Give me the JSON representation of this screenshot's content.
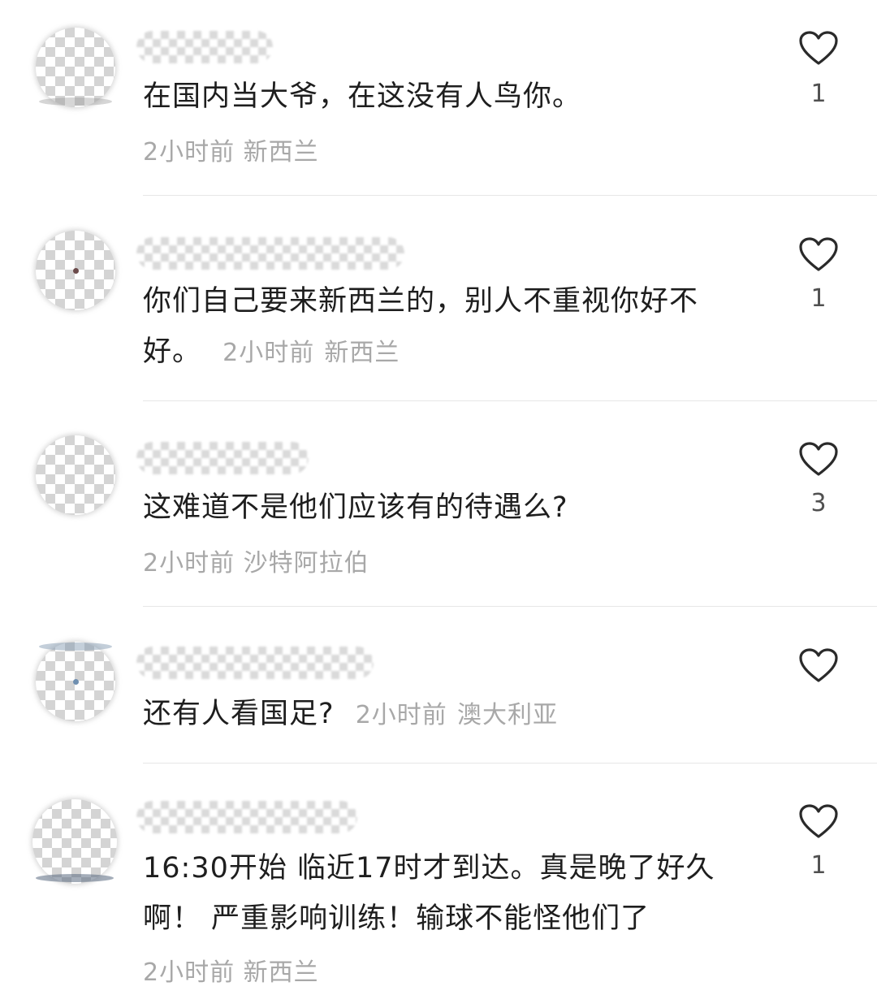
{
  "comments": [
    {
      "text": "在国内当大爷，在这没有人鸟你。",
      "time": "2小时前",
      "location": "新西兰",
      "likes": "1"
    },
    {
      "text_line1": "你们自己要来新西兰的，别人不重视你好不",
      "text_line2": "好。",
      "time": "2小时前",
      "location": "新西兰",
      "likes": "1"
    },
    {
      "text": "这难道不是他们应该有的待遇么?",
      "time": "2小时前",
      "location": "沙特阿拉伯",
      "likes": "3"
    },
    {
      "text": "还有人看国足?",
      "time": "2小时前",
      "location": "澳大利亚",
      "likes": ""
    },
    {
      "text_line1": "16:30开始 临近17时才到达。真是晚了好久",
      "text_line2": "啊！ 严重影响训练！输球不能怪他们了",
      "time": "2小时前",
      "location": "新西兰",
      "likes": "1"
    }
  ],
  "icons": {
    "like": "heart-outline-icon"
  },
  "colors": {
    "text": "#1e1e1e",
    "meta": "#a8a8a8",
    "divider": "#e6e6e6"
  }
}
